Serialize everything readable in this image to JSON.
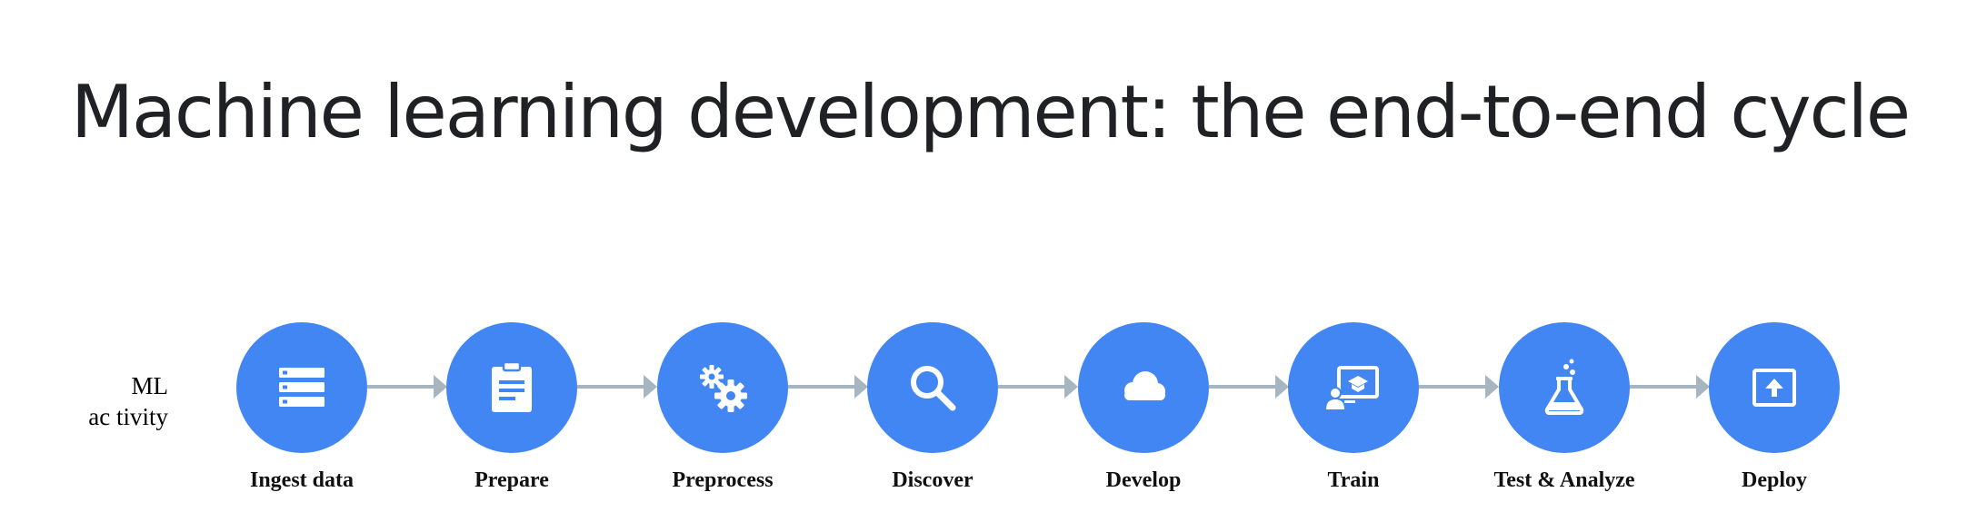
{
  "title": "Machine learning development: the end-to-end cycle",
  "row_label": {
    "line1": "ML",
    "line2": "ac tivity"
  },
  "colors": {
    "circle": "#4286f4",
    "arrow": "#a7b5c1",
    "icon": "#ffffff"
  },
  "steps": [
    {
      "label": "Ingest data",
      "icon": "server-stack-icon"
    },
    {
      "label": "Prepare",
      "icon": "clipboard-icon"
    },
    {
      "label": "Preprocess",
      "icon": "gears-icon"
    },
    {
      "label": "Discover",
      "icon": "magnifier-icon"
    },
    {
      "label": "Develop",
      "icon": "cloud-icon"
    },
    {
      "label": "Train",
      "icon": "presentation-icon"
    },
    {
      "label": "Test & Analyze",
      "icon": "flask-icon"
    },
    {
      "label": "Deploy",
      "icon": "upload-screen-icon"
    }
  ]
}
